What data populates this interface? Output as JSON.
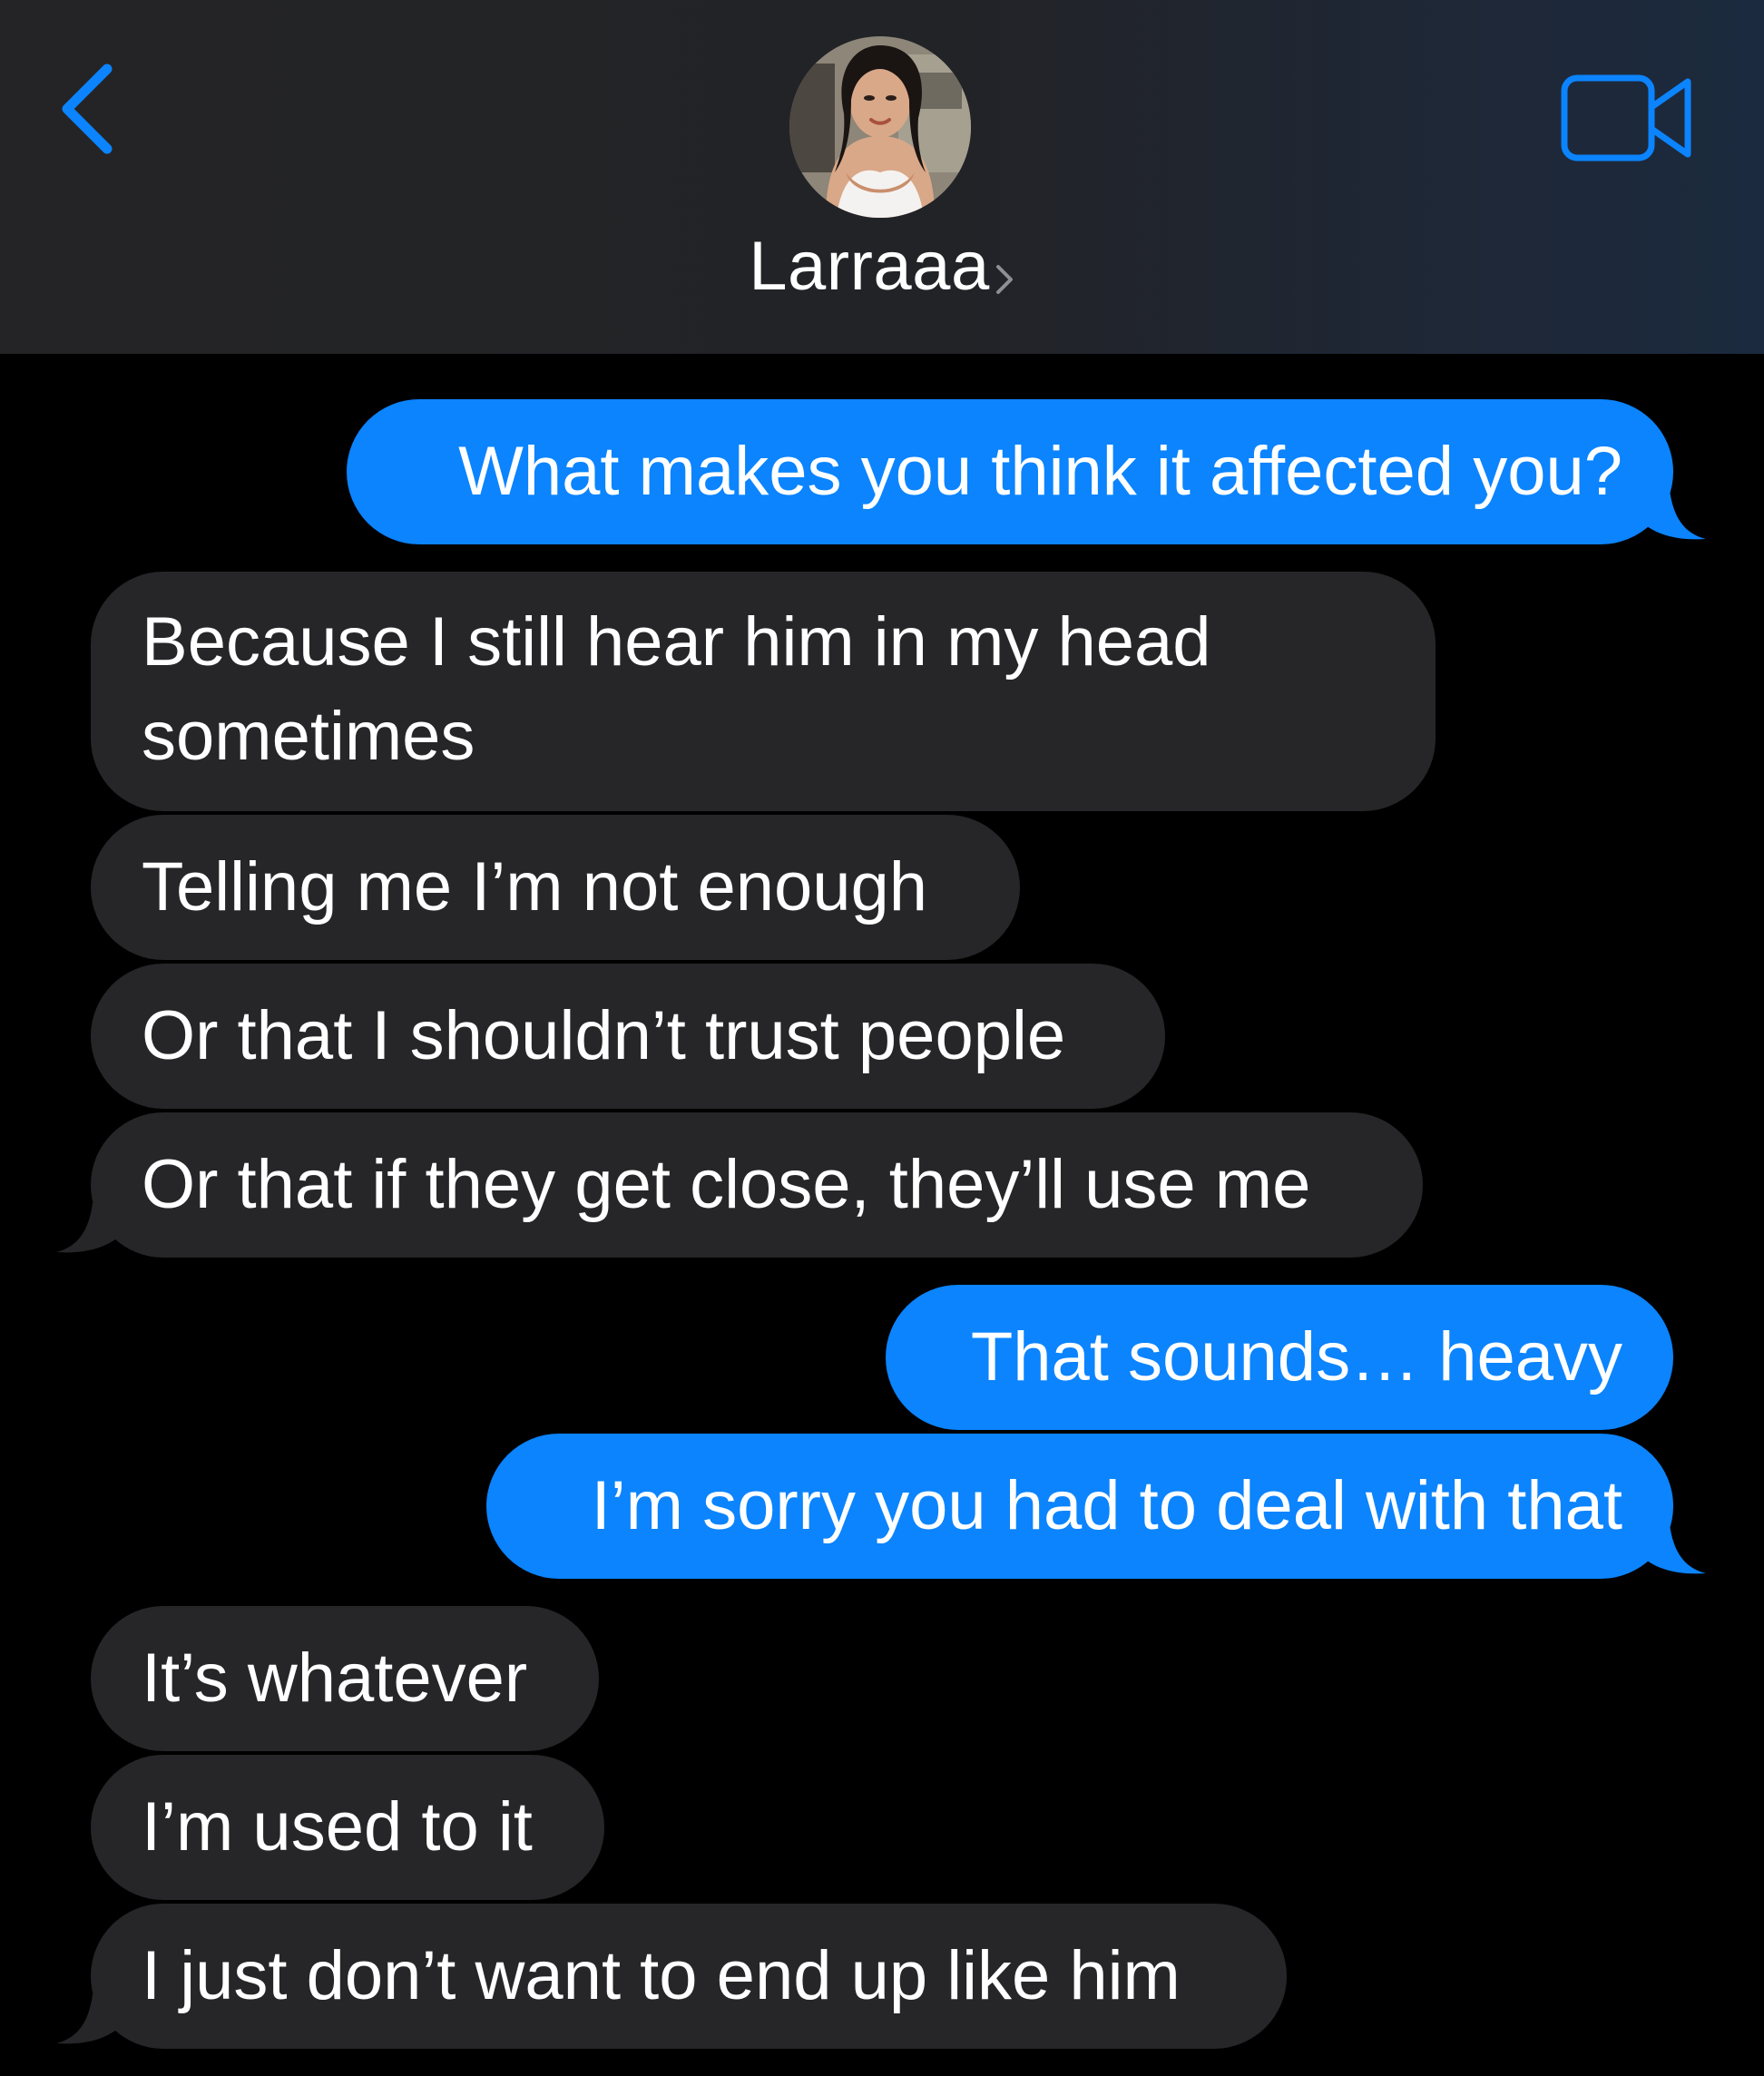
{
  "colors": {
    "accent": "#0b84fe",
    "incoming_bubble": "#262628",
    "background": "#000000",
    "header_background": "#232427"
  },
  "header": {
    "back_icon": "chevron-left-icon",
    "contact_name": "Larraaa",
    "contact_chevron_icon": "chevron-right-icon",
    "video_icon": "video-camera-icon"
  },
  "messages": [
    {
      "direction": "outgoing",
      "text": "What makes you think it affected you?"
    },
    {
      "direction": "incoming",
      "text": "Because I still hear him in my head sometimes"
    },
    {
      "direction": "incoming",
      "text": "Telling me I’m not enough"
    },
    {
      "direction": "incoming",
      "text": "Or that I shouldn’t trust people"
    },
    {
      "direction": "incoming",
      "text": "Or that if they get close, they’ll use me"
    },
    {
      "direction": "outgoing",
      "text": "That sounds… heavy"
    },
    {
      "direction": "outgoing",
      "text": "I’m sorry you had to deal with that"
    },
    {
      "direction": "incoming",
      "text": "It’s whatever"
    },
    {
      "direction": "incoming",
      "text": "I’m used to it"
    },
    {
      "direction": "incoming",
      "text": "I just don’t want to end up like him"
    }
  ]
}
